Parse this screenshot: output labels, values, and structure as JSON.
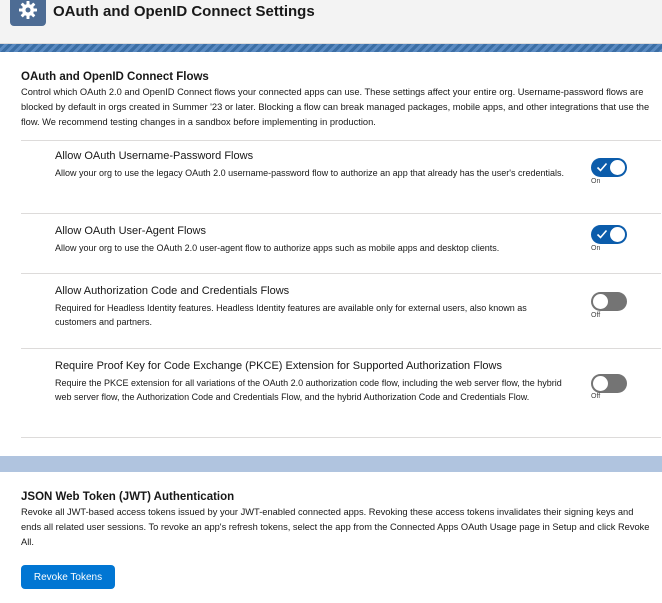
{
  "header": {
    "title": "OAuth and OpenID Connect Settings",
    "icon": "gear-icon"
  },
  "flows_section": {
    "title": "OAuth and OpenID Connect Flows",
    "description": "Control which OAuth 2.0 and OpenID Connect flows your connected apps can use. These settings affect your entire org. Username-password flows are blocked by default in orgs created in Summer '23 or later. Blocking a flow can break managed packages, mobile apps, and other integrations that use the flow. We recommend testing changes in a sandbox before implementing in production.",
    "items": [
      {
        "title": "Allow OAuth Username-Password Flows",
        "description": "Allow your org to use the legacy OAuth 2.0 username-password flow to authorize an app that already has the user's credentials.",
        "state": "On",
        "enabled": true
      },
      {
        "title": "Allow OAuth User-Agent Flows",
        "description": "Allow your org to use the OAuth 2.0 user-agent flow to authorize apps such as mobile apps and desktop clients.",
        "state": "On",
        "enabled": true
      },
      {
        "title": "Allow Authorization Code and Credentials Flows",
        "description": "Required for Headless Identity features. Headless Identity features are available only for external users, also known as customers and partners.",
        "state": "Off",
        "enabled": false
      },
      {
        "title": "Require Proof Key for Code Exchange (PKCE) Extension for Supported Authorization Flows",
        "description": "Require the PKCE extension for all variations of the OAuth 2.0 authorization code flow, including the web server flow, the hybrid web server flow, the Authorization Code and Credentials Flow, and the hybrid Authorization Code and Credentials Flow.",
        "state": "Off",
        "enabled": false
      }
    ]
  },
  "jwt_section": {
    "title": "JSON Web Token (JWT) Authentication",
    "description": "Revoke all JWT-based access tokens issued by your JWT-enabled connected apps. Revoking these access tokens invalidates their signing keys and ends all related user sessions. To revoke an app's refresh tokens, select the app from the Connected Apps OAuth Usage page in Setup and click Revoke All.",
    "button_label": "Revoke Tokens"
  },
  "colors": {
    "toggle_on": "#0b5cab",
    "toggle_off": "#747474",
    "button": "#0176d3",
    "header_icon_bg": "#4d6c94"
  }
}
